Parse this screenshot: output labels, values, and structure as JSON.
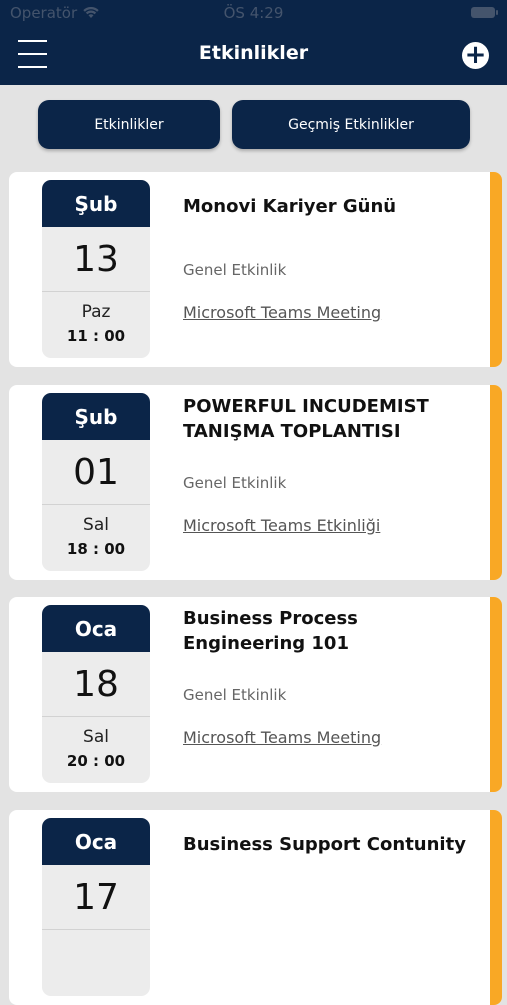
{
  "status_bar": {
    "carrier": "Operatör",
    "time": "ÖS 4:29"
  },
  "header": {
    "title": "Etkinlikler"
  },
  "tabs": [
    {
      "label": "Etkinlikler"
    },
    {
      "label": "Geçmiş Etkinlikler"
    }
  ],
  "colors": {
    "navy": "#0b2548",
    "accent": "#f9a825",
    "background": "#e3e3e3"
  },
  "icons": {
    "menu": "hamburger-icon",
    "add": "plus-circle-icon",
    "wifi": "wifi-icon",
    "battery": "battery-icon"
  },
  "events": [
    {
      "month": "Şub",
      "day": "13",
      "weekday": "Paz",
      "time": "11 : 00",
      "title": "Monovi Kariyer Günü",
      "type": "Genel Etkinlik",
      "link": "Microsoft Teams Meeting"
    },
    {
      "month": "Şub",
      "day": "01",
      "weekday": "Sal",
      "time": "18 : 00",
      "title": "POWERFUL INCUDEMIST TANIŞMA TOPLANTISI",
      "type": "Genel Etkinlik",
      "link": "Microsoft Teams Etkinliği"
    },
    {
      "month": "Oca",
      "day": "18",
      "weekday": "Sal",
      "time": "20 : 00",
      "title": "Business Process Engineering 101",
      "type": "Genel Etkinlik",
      "link": "Microsoft Teams Meeting"
    },
    {
      "month": "Oca",
      "day": "17",
      "weekday": "",
      "time": "",
      "title": "Business Support Contunity",
      "type": "",
      "link": ""
    }
  ]
}
